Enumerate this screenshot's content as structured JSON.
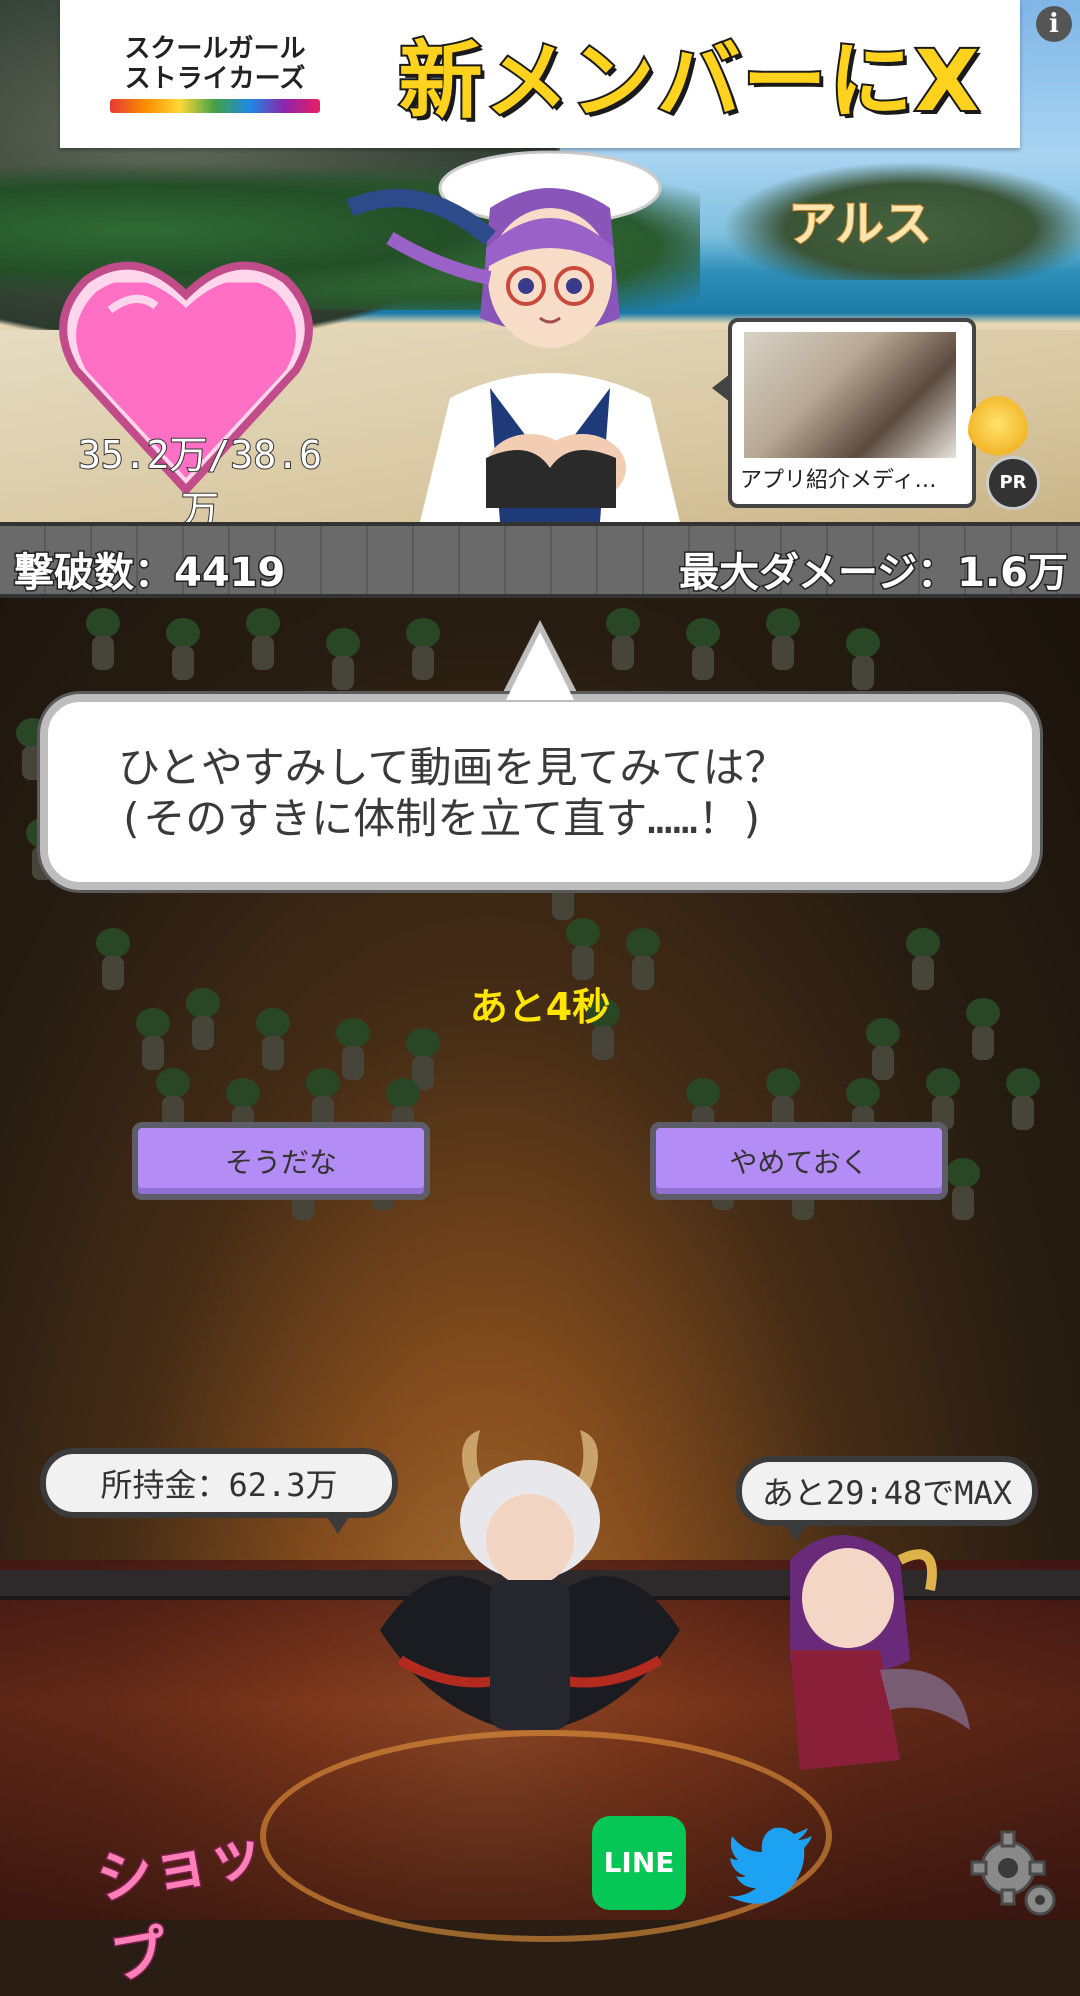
{
  "ad": {
    "logo_line1": "スクールガール",
    "logo_line2": "ストライカーズ",
    "headline": "新メンバーにX",
    "info_icon": "i"
  },
  "boss": {
    "name": "アルス",
    "hp_text": "35.2万/38.6万",
    "hp_fraction": 0.91
  },
  "pr": {
    "caption": "アプリ紹介メディ…",
    "badge": "PR"
  },
  "stats": {
    "kills": "撃破数：4419",
    "max_damage": "最大ダメージ：1.6万"
  },
  "dialog": {
    "line1": "ひとやすみして動画を見てみては？",
    "line2": "(そのすきに体制を立て直す……！)",
    "countdown": "あと4秒",
    "yes_label": "そうだな",
    "no_label": "やめておく"
  },
  "hud": {
    "money": "所持金：62.3万",
    "stamina_timer": "あと29:48でMAX",
    "shop_label": "ショップ",
    "line_label": "LINE"
  },
  "icons": {
    "ad_info": "info-icon",
    "twitter": "twitter-bird-icon",
    "settings": "gear-icon",
    "line": "line-icon"
  },
  "colors": {
    "heart": "#ff6fc4",
    "button": "#b48cf6",
    "countdown": "#ffe600",
    "line": "#06c755",
    "twitter": "#1da1f2"
  }
}
